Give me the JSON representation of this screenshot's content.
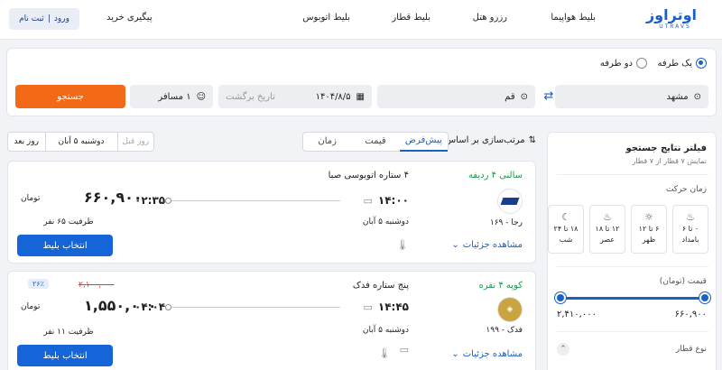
{
  "header": {
    "logo_fa": "اوتراوز",
    "logo_en": "UTRAVS",
    "nav": [
      "بلیط هواپیما",
      "رزرو هتل",
      "بلیط قطار",
      "بلیط اتوبوس"
    ],
    "track_order": "پیگیری خرید",
    "login": "ورود",
    "separator": "|",
    "register": "ثبت نام"
  },
  "search": {
    "trip_one_way": "یک طرفه",
    "trip_round": "دو طرفه",
    "origin": "مشهد",
    "destination": "قم",
    "depart_date": "۱۴۰۴/۸/۵",
    "return_placeholder": "تاریخ برگشت",
    "passengers": "۱ مسافر",
    "search_button": "جستجو",
    "swap_icon": "swap-arrows"
  },
  "sort": {
    "label": "مرتب‌سازی بر اساس:",
    "options": [
      "پیش‌فرض",
      "قیمت",
      "زمان"
    ],
    "active": 0
  },
  "days": {
    "prev": "روز قبل",
    "current": "دوشنبه ۵ آبان",
    "next": "روز بعد"
  },
  "filters": {
    "title": "فیلتر نتایج جستجو",
    "subtitle": "نمایش ۷ قطار از ۷ قطار",
    "time_title": "زمان حرکت",
    "time_slots": [
      {
        "range": "۰ تا ۶",
        "label": "بامداد",
        "icon": "sunrise-icon"
      },
      {
        "range": "۶ تا ۱۲",
        "label": "ظهر",
        "icon": "sun-icon"
      },
      {
        "range": "۱۲ تا ۱۸",
        "label": "عصر",
        "icon": "sunset-icon"
      },
      {
        "range": "۱۸ تا ۲۴",
        "label": "شب",
        "icon": "moon-icon"
      }
    ],
    "price_title": "قیمت (تومان)",
    "price_min": "۶۶۰,۹۰۰",
    "price_max": "۲,۴۱۰,۰۰۰",
    "train_type_title": "نوع قطار"
  },
  "results": [
    {
      "type": "سالنی ۴ ردیفه",
      "name": "۴ ستاره اتوبوسی صبا",
      "train_no": "رجا - ۱۶۹",
      "depart": "۱۴:۰۰",
      "arrive": "۰۲:۳۵",
      "date": "دوشنبه ۵ آبان",
      "price": "۶۶۰,۹۰۰",
      "currency": "تومان",
      "capacity": "ظرفیت ۶۵ نفر",
      "select": "انتخاب بلیط",
      "details": "مشاهده جزئیات"
    },
    {
      "type": "کوپه ۴ نفره",
      "name": "پنج ستاره فدک",
      "train_no": "فدک - ۱۹۹",
      "depart": "۱۴:۴۵",
      "arrive": "۰۴:۰۴",
      "date": "دوشنبه ۵ آبان",
      "old_price": "۲,۱۰۰,۰۰۰",
      "discount": "۲۶٪",
      "price": "۱,۵۵۰,۰۰۰",
      "currency": "تومان",
      "capacity": "ظرفیت ۱۱ نفر",
      "select": "انتخاب بلیط",
      "details": "مشاهده جزئیات"
    }
  ],
  "colors": {
    "primary": "#1a60c8",
    "orange": "#f26a18",
    "green": "#1d9a4f",
    "red": "#e5392c",
    "background": "#f1f3f6"
  }
}
